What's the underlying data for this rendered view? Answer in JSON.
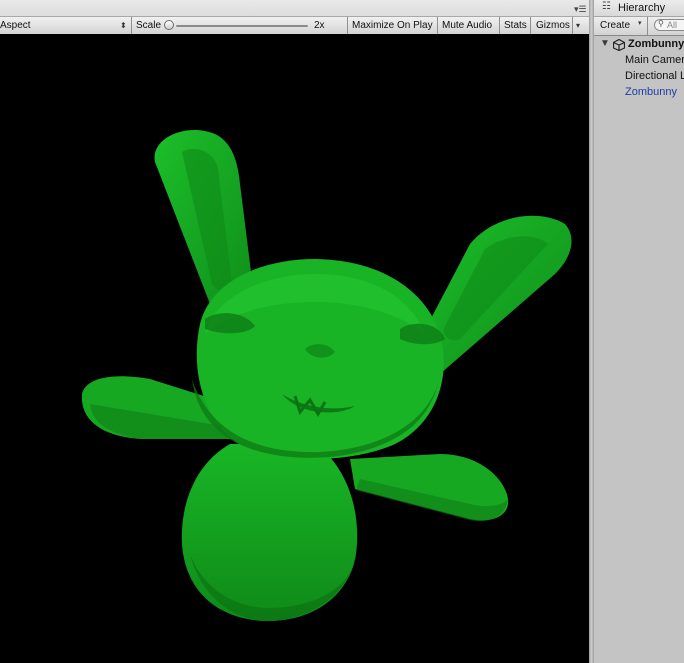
{
  "game_view": {
    "aspect_label": "Aspect",
    "scale_label": "Scale",
    "scale_value": "2x",
    "scale_slider_fraction": 0.0,
    "maximize_on_play": "Maximize On Play",
    "mute_audio": "Mute Audio",
    "stats": "Stats",
    "gizmos": "Gizmos",
    "background_color": "#000000",
    "model_color": "#14a51e"
  },
  "hierarchy": {
    "tab_title": "Hierarchy",
    "create_label": "Create",
    "search_placeholder": "All",
    "scene_name": "Zombunny",
    "items": [
      {
        "label": "Main Camera"
      },
      {
        "label": "Directional Light"
      },
      {
        "label": "Zombunny"
      }
    ],
    "selected_color": "#1c3da8"
  }
}
